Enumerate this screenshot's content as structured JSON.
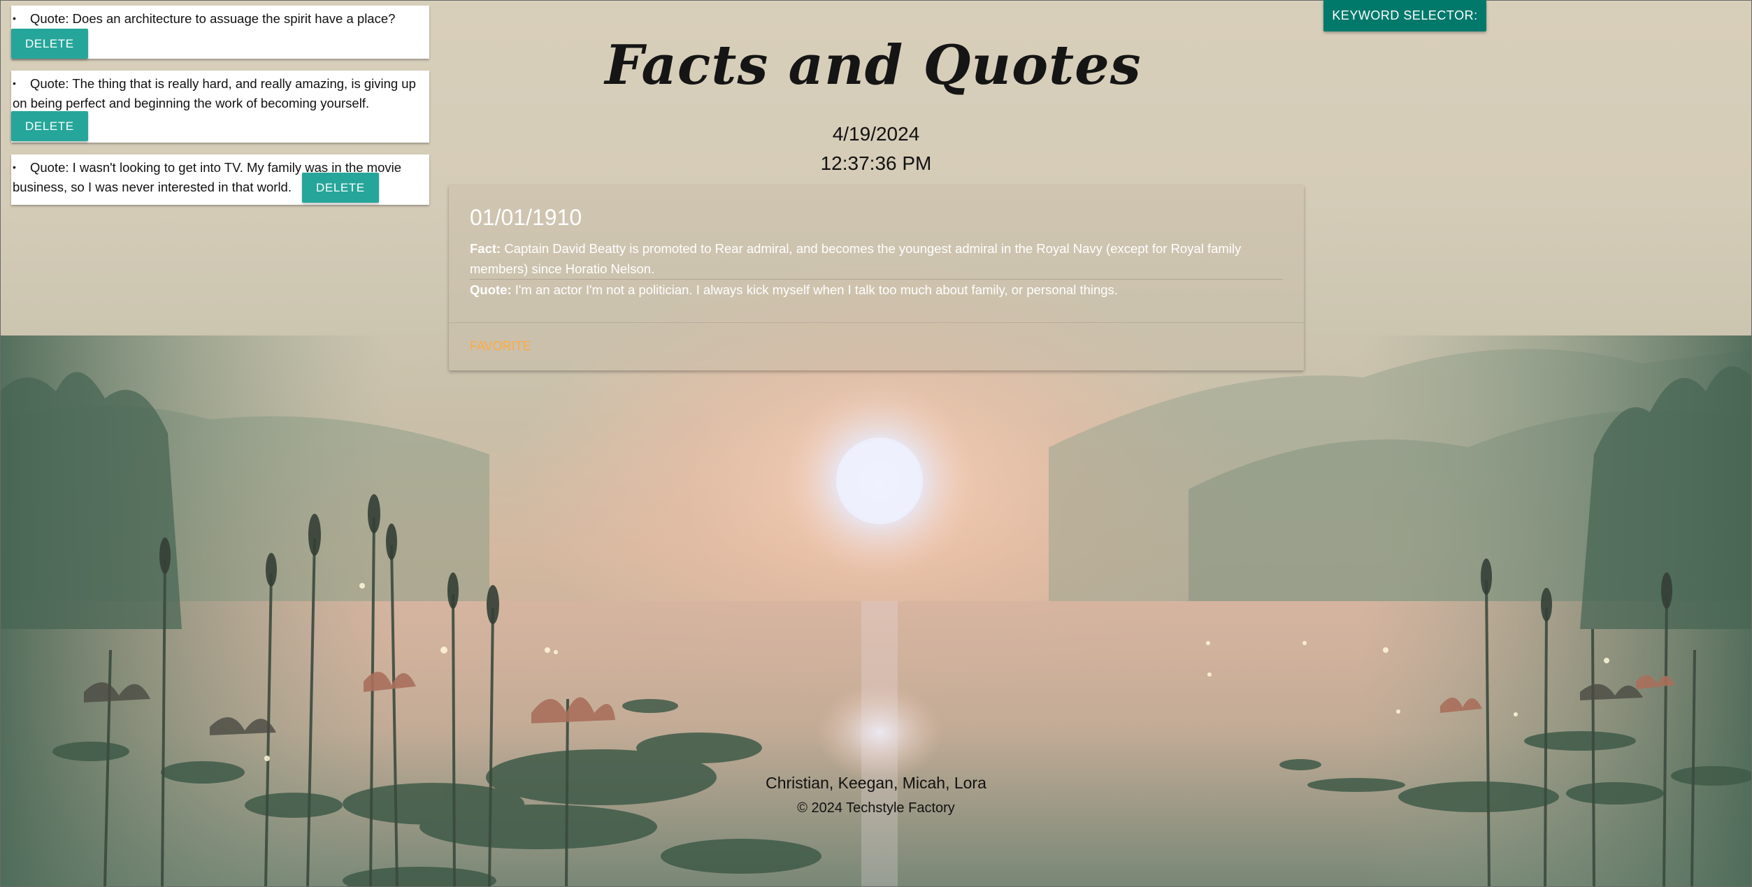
{
  "page": {
    "title": "Facts and Quotes",
    "date": "4/19/2024",
    "time": "12:37:36 PM"
  },
  "keyword_selector": {
    "label": "KEYWORD SELECTOR:"
  },
  "saved_quotes": [
    {
      "bullet": "•",
      "text": "Quote: Does an architecture to assuage the spirit have a place?",
      "delete_label": "DELETE"
    },
    {
      "bullet": "•",
      "text": "Quote: The thing that is really hard, and really amazing, is giving up on being perfect and beginning the work of becoming yourself.",
      "delete_label": "DELETE"
    },
    {
      "bullet": "•",
      "text": "Quote: I wasn't looking to get into TV. My family was in the movie business, so I was never interested in that world.",
      "delete_label": "DELETE"
    }
  ],
  "fact_card": {
    "date": "01/01/1910",
    "fact_label": "Fact:",
    "fact_text": "Captain David Beatty is promoted to Rear admiral, and becomes the youngest admiral in the Royal Navy (except for Royal family members) since Horatio Nelson.",
    "quote_label": "Quote:",
    "quote_text": "I'm an actor I'm not a politician. I always kick myself when I talk too much about family, or personal things.",
    "favorite_label": "FAVORITE"
  },
  "footer": {
    "names": "Christian, Keegan, Micah, Lora",
    "copyright": "© 2024 Techstyle Factory"
  },
  "colors": {
    "delete_button": "#26a69a",
    "keyword_button": "#00796b",
    "favorite": "#ffab40"
  },
  "icons": {
    "background": "lotus-pond-sunset-image"
  }
}
